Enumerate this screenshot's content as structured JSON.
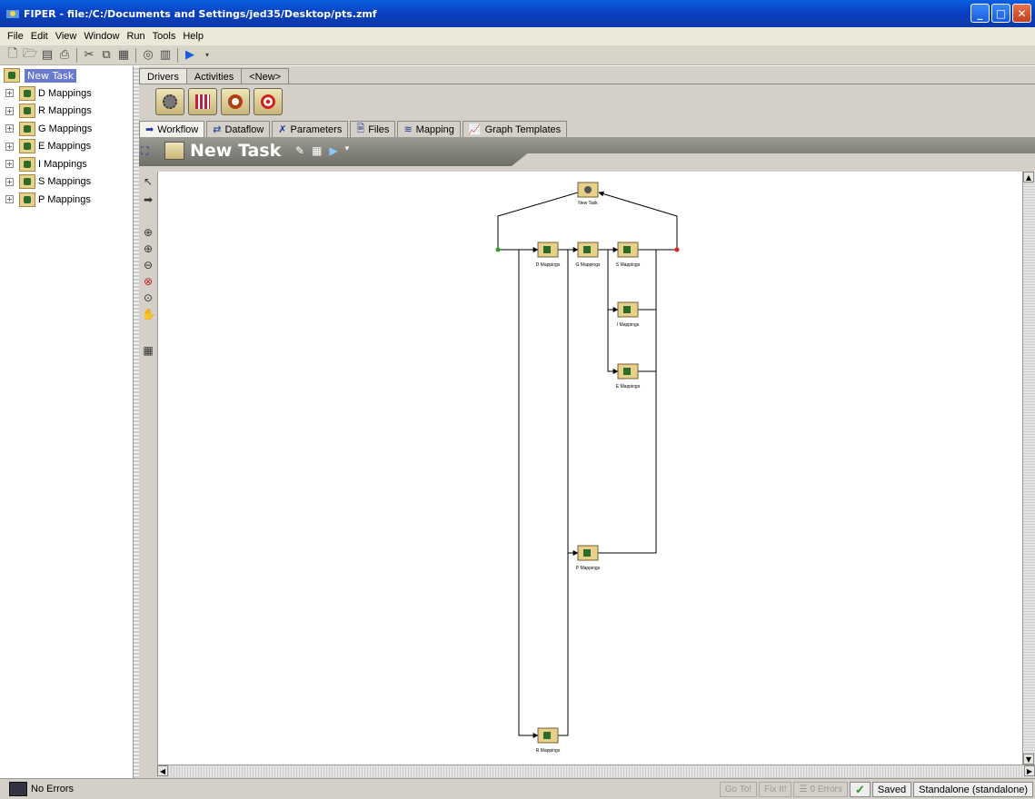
{
  "window": {
    "title": "FIPER - file:/C:/Documents and Settings/jed35/Desktop/pts.zmf",
    "controls": [
      "minimize",
      "maximize",
      "close"
    ]
  },
  "menu": [
    "File",
    "Edit",
    "View",
    "Window",
    "Run",
    "Tools",
    "Help"
  ],
  "toolbar_icons": [
    "new-icon",
    "open-icon",
    "save-icon",
    "print-icon",
    "cut-icon",
    "copy-icon",
    "paste-icon",
    "globe-icon",
    "library-icon",
    "run-icon",
    "dropdown-icon"
  ],
  "tree": {
    "root": "New Task",
    "items": [
      "D Mappings",
      "R Mappings",
      "G Mappings",
      "E Mappings",
      "I Mappings",
      "S Mappings",
      "P Mappings"
    ]
  },
  "tabs_top": [
    "Drivers",
    "Activities",
    "<New>"
  ],
  "tabs_main": [
    {
      "label": "Workflow",
      "icon": "arrow-icon"
    },
    {
      "label": "Dataflow",
      "icon": "dataflow-icon"
    },
    {
      "label": "Parameters",
      "icon": "parameters-icon"
    },
    {
      "label": "Files",
      "icon": "files-icon"
    },
    {
      "label": "Mapping",
      "icon": "mapping-icon"
    },
    {
      "label": "Graph Templates",
      "icon": "graph-icon"
    }
  ],
  "header": {
    "title": "New Task"
  },
  "workflow": {
    "nodes": [
      "New Task",
      "D Mappings",
      "G Mappings",
      "S Mappings",
      "I Mappings",
      "E Mappings",
      "P Mappings",
      "R Mappings"
    ]
  },
  "status": {
    "message": "No Errors",
    "goto": "Go To!",
    "fix": "Fix It!",
    "errors": "0 Errors",
    "saved": "Saved",
    "mode": "Standalone (standalone)"
  },
  "colors": {
    "titlebar": "#0a4ed0",
    "chrome": "#d4d0c8",
    "selection": "#6a7ad0",
    "start_node": "#2aa02a",
    "end_node": "#e02020"
  }
}
